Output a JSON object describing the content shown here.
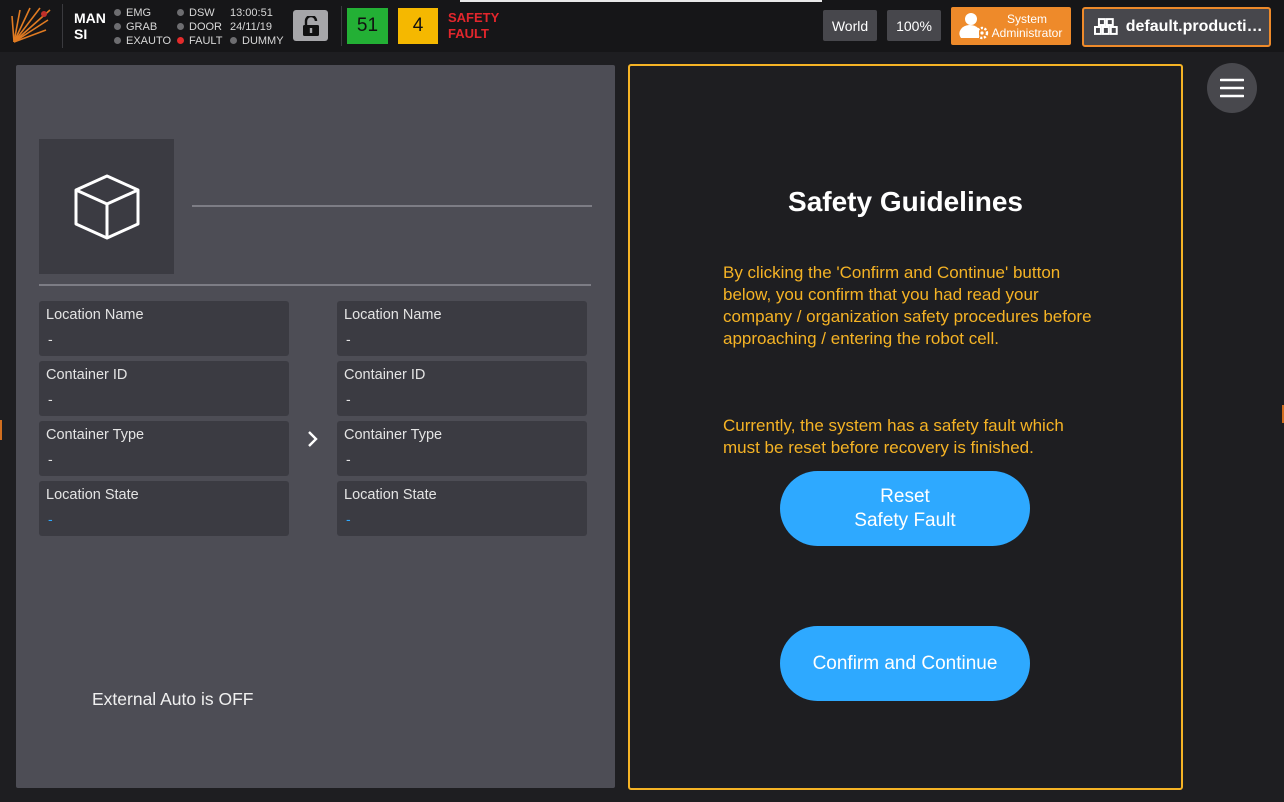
{
  "topbar": {
    "mode_line1": "MAN",
    "mode_line2": "SI",
    "signals_col1": [
      "EMG",
      "GRAB",
      "EXAUTO"
    ],
    "signals_col2": [
      "DSW",
      "DOOR",
      "FAULT"
    ],
    "time": "13:00:51",
    "date": "24/11/19",
    "dummy": "DUMMY",
    "count_green": "51",
    "count_yellow": "4",
    "safety_line1": "SAFETY",
    "safety_line2": "FAULT",
    "world_label": "World",
    "zoom_label": "100%",
    "user_line1": "System",
    "user_line2": "Administrator",
    "production_label": "default.production..."
  },
  "left_panel": {
    "source": [
      {
        "label": "Location Name",
        "value": "-"
      },
      {
        "label": "Container ID",
        "value": "-"
      },
      {
        "label": "Container Type",
        "value": "-"
      },
      {
        "label": "Location State",
        "value": "-"
      }
    ],
    "target": [
      {
        "label": "Location Name",
        "value": "-"
      },
      {
        "label": "Container ID",
        "value": "-"
      },
      {
        "label": "Container Type",
        "value": "-"
      },
      {
        "label": "Location State",
        "value": "-"
      }
    ],
    "external_auto": "External Auto is OFF"
  },
  "right_panel": {
    "title": "Safety Guidelines",
    "paragraph1": "By clicking the 'Confirm and Continue' button below, you confirm that you had read your company / organization safety procedures before approaching / entering the robot cell.",
    "paragraph2": "Currently, the system has a safety fault which must be reset before recovery is finished.",
    "reset_line1": "Reset",
    "reset_line2": "Safety Fault",
    "confirm_label": "Confirm and Continue"
  },
  "colors": {
    "accent_orange": "#ee8a2a",
    "warning_yellow": "#f5b325",
    "button_blue": "#2ea9ff",
    "fault_red": "#e3262c",
    "ok_green": "#23b035"
  },
  "icons": [
    "logo-icon",
    "lock-icon",
    "user-gear-icon",
    "robots-icon",
    "cube-icon",
    "chevron-right-icon",
    "hamburger-menu-icon"
  ]
}
